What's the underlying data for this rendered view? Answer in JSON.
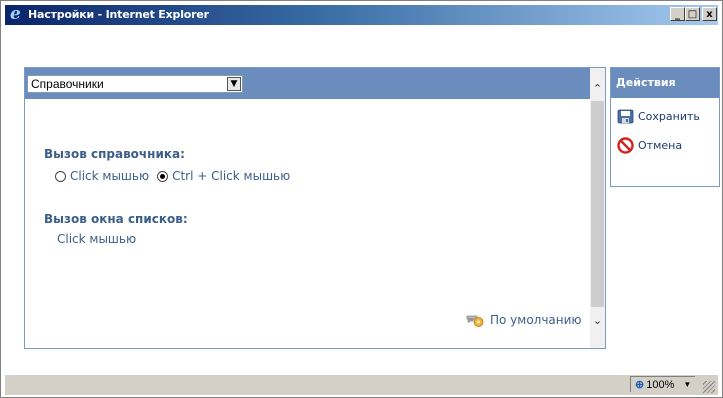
{
  "window": {
    "title": "Настройки - Internet Explorer",
    "minimize": "_",
    "maximize": "□",
    "close": "x"
  },
  "main": {
    "select": {
      "value": "Справочники"
    },
    "section1_label": "Вызов справочника:",
    "radio_options": [
      {
        "label": "Click мышью",
        "checked": false
      },
      {
        "label": "Ctrl + Click мышью",
        "checked": true
      }
    ],
    "section2_label": "Вызов окна списков:",
    "section2_value": "Click мышью",
    "default_link": "По умолчанию"
  },
  "actions": {
    "header": "Действия",
    "items": [
      {
        "label": "Сохранить",
        "icon": "save-icon"
      },
      {
        "label": "Отмена",
        "icon": "cancel-icon"
      }
    ]
  },
  "status": {
    "zoom": "100%"
  },
  "colors": {
    "header_blue": "#6a8dbd",
    "label_blue": "#3b5f8a",
    "title_gradient_start": "#0a246a"
  }
}
